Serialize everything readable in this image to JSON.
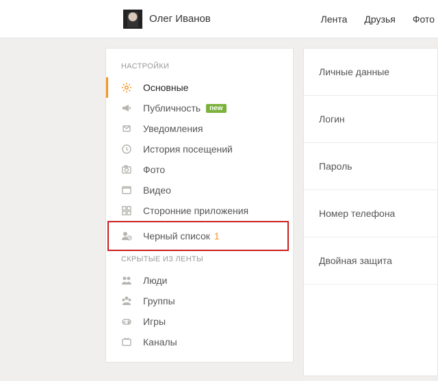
{
  "header": {
    "username": "Олег Иванов",
    "nav": {
      "feed": "Лента",
      "friends": "Друзья",
      "photo": "Фото"
    }
  },
  "sidebar": {
    "sections": [
      {
        "title": "НАСТРОЙКИ",
        "items": [
          {
            "id": "settings-general",
            "label": "Основные",
            "icon": "gear",
            "active": true
          },
          {
            "id": "settings-publicity",
            "label": "Публичность",
            "icon": "megaphone",
            "badge": "new"
          },
          {
            "id": "settings-notify",
            "label": "Уведомления",
            "icon": "bell"
          },
          {
            "id": "settings-history",
            "label": "История посещений",
            "icon": "history"
          },
          {
            "id": "settings-photo",
            "label": "Фото",
            "icon": "camera"
          },
          {
            "id": "settings-video",
            "label": "Видео",
            "icon": "video"
          },
          {
            "id": "settings-apps",
            "label": "Сторонние приложения",
            "icon": "apps"
          },
          {
            "id": "settings-blacklist",
            "label": "Черный список",
            "icon": "user-block",
            "count": "1",
            "highlight": true
          }
        ]
      },
      {
        "title": "СКРЫТЫЕ ИЗ ЛЕНТЫ",
        "items": [
          {
            "id": "hidden-people",
            "label": "Люди",
            "icon": "people"
          },
          {
            "id": "hidden-groups",
            "label": "Группы",
            "icon": "group"
          },
          {
            "id": "hidden-games",
            "label": "Игры",
            "icon": "gamepad"
          },
          {
            "id": "hidden-channels",
            "label": "Каналы",
            "icon": "tv"
          }
        ]
      }
    ]
  },
  "main": {
    "items": [
      {
        "id": "personal-data",
        "label": "Личные данные"
      },
      {
        "id": "login",
        "label": "Логин"
      },
      {
        "id": "password",
        "label": "Пароль"
      },
      {
        "id": "phone",
        "label": "Номер телефона"
      },
      {
        "id": "two-factor",
        "label": "Двойная защита"
      }
    ]
  }
}
